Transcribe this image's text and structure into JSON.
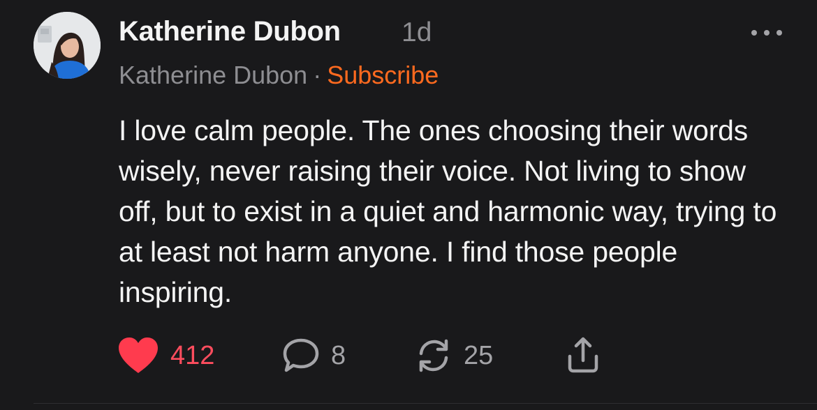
{
  "post": {
    "author": "Katherine Dubon",
    "age": "1d",
    "publication": "Katherine Dubon",
    "separator": "·",
    "subscribe_label": "Subscribe",
    "text": "I love calm people. The ones choosing their words wisely, never raising their voice. Not living to show off, but to exist in a quiet and harmonic way, trying to at least not harm anyone. I find those people inspiring.",
    "actions": {
      "likes": "412",
      "comments": "8",
      "restacks": "25"
    }
  },
  "icons": {
    "like": "heart-icon",
    "comment": "comment-bubble-icon",
    "restack": "restack-icon",
    "share": "share-icon",
    "more": "more-dots-icon"
  },
  "colors": {
    "background": "#19191b",
    "accent_subscribe": "#ff6a1f",
    "like_red": "#ff4d5e",
    "muted": "#8e8e92",
    "text": "#f4f4f4"
  }
}
